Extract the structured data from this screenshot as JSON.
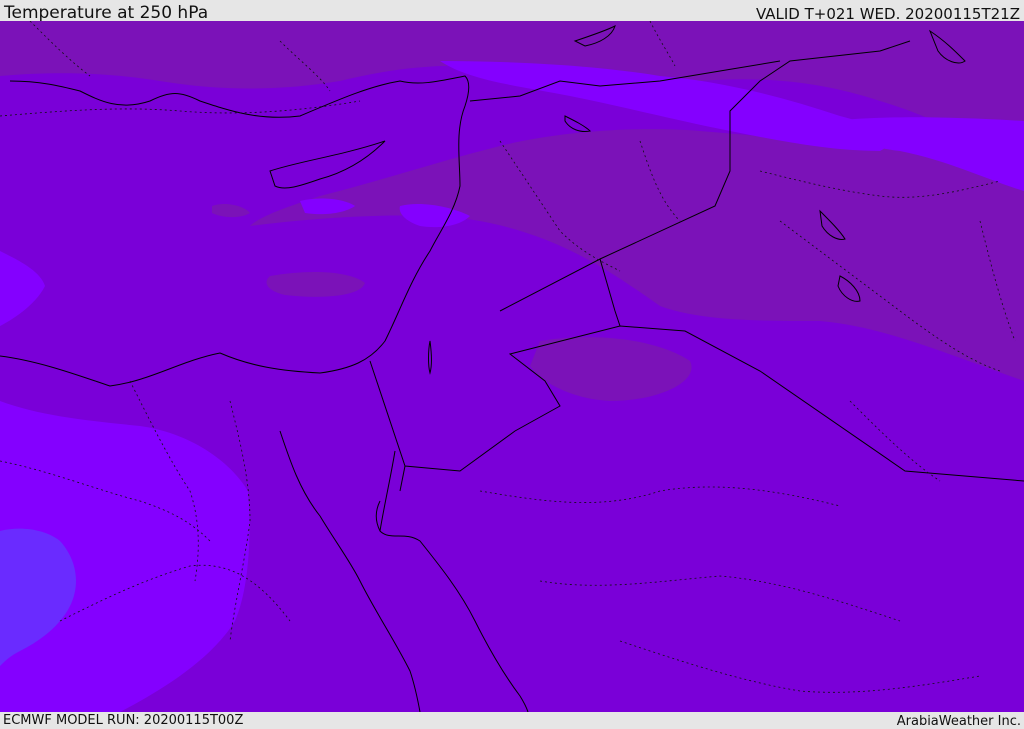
{
  "header": {
    "title": "Temperature at 250 hPa",
    "valid": "VALID T+021 WED. 20200115T21Z"
  },
  "footer": {
    "model_run": "ECMWF MODEL RUN: 20200115T00Z",
    "credit": "ArabiaWeather Inc."
  },
  "colors": {
    "background_fill": "#7a00d8",
    "warm_band": "#7b12b8",
    "cool_band": "#8400ff",
    "coldest_patch": "#6a2bff",
    "coastline": "#000000",
    "border": "#000000",
    "chrome": "#e6e6e6"
  }
}
